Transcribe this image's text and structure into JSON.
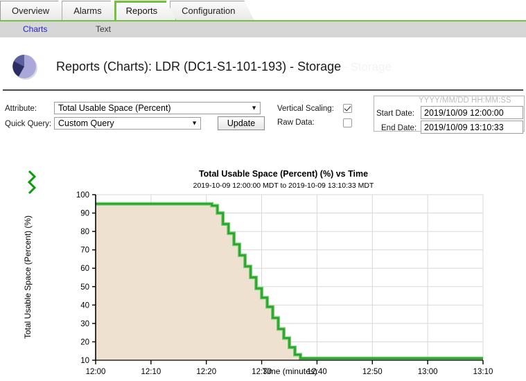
{
  "tabs": [
    {
      "label": "Overview",
      "active": false
    },
    {
      "label": "Alarms",
      "active": false
    },
    {
      "label": "Reports",
      "active": true
    },
    {
      "label": "Configuration",
      "active": false
    }
  ],
  "subtabs": [
    {
      "label": "Charts",
      "active": true
    },
    {
      "label": "Text",
      "active": false
    }
  ],
  "header": {
    "title": "Reports (Charts): LDR (DC1-S1-101-193) - Storage",
    "ghost_title": "- Storage"
  },
  "controls": {
    "attribute_label": "Attribute:",
    "attribute_value": "Total Usable Space (Percent)",
    "quick_query_label": "Quick Query:",
    "quick_query_value": "Custom Query",
    "update_label": "Update",
    "vertical_scaling_label": "Vertical Scaling:",
    "vertical_scaling_checked": true,
    "raw_data_label": "Raw Data:",
    "raw_data_checked": false,
    "date_format_hint": "YYYY/MM/DD HH:MM:SS",
    "start_date_label": "Start Date:",
    "start_date_value": "2019/10/09 12:00:00",
    "end_date_label": "End Date:",
    "end_date_value": "2019/10/09 13:10:33",
    "dropdown_arrow": "▼"
  },
  "colors": {
    "accent_green": "#76c043",
    "line_green": "#2aa02a",
    "line_green_light": "#6fcf6f",
    "fill_tan": "#eee1cf",
    "grid": "#d8d8d8",
    "link_blue": "#2222cc"
  },
  "chart_data": {
    "type": "area",
    "title": "Total Usable Space (Percent) (%) vs Time",
    "subtitle": "2019-10-09 12:00:00 MDT to 2019-10-09 13:10:33 MDT",
    "xlabel": "Time (minutes)",
    "ylabel": "Total Usable Space (Percent) (%)",
    "ylim": [
      10,
      100
    ],
    "yticks": [
      10,
      20,
      30,
      40,
      50,
      60,
      70,
      80,
      90,
      100
    ],
    "xticks": [
      "12:00",
      "12:10",
      "12:20",
      "12:30",
      "12:40",
      "12:50",
      "13:00",
      "13:10"
    ],
    "xlim_minutes": [
      0,
      70
    ],
    "grid": true,
    "legend": "none",
    "axis_break_marker": true,
    "series": [
      {
        "name": "Total Usable Space (Percent)",
        "x_minutes": [
          0,
          2,
          4,
          6,
          8,
          10,
          12,
          14,
          16,
          18,
          20,
          21,
          22,
          23,
          24,
          25,
          26,
          27,
          28,
          29,
          30,
          31,
          32,
          33,
          34,
          35,
          36,
          37,
          38,
          40,
          45,
          50,
          55,
          60,
          65,
          70
        ],
        "values": [
          95,
          95,
          95,
          95,
          95,
          95,
          95,
          95,
          95,
          95,
          95,
          94,
          90,
          84,
          79,
          73,
          67,
          61,
          55,
          49,
          44,
          39,
          33,
          27,
          22,
          17,
          13,
          11,
          11,
          11,
          11,
          11,
          11,
          11,
          11,
          11
        ]
      }
    ]
  }
}
